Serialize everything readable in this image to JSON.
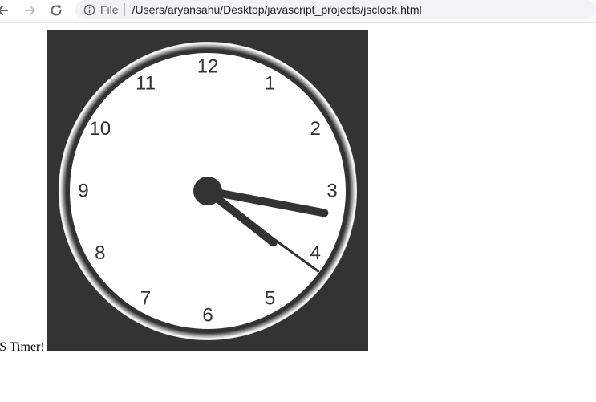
{
  "browser": {
    "scheme_label": "File",
    "url": "/Users/aryansahu/Desktop/javascript_projects/jsclock.html",
    "icons": {
      "back": "arrow-left",
      "forward": "arrow-right",
      "reload": "reload",
      "info": "info-circle"
    }
  },
  "page": {
    "body_text": "JS Timer!"
  },
  "clock": {
    "numerals": [
      "12",
      "1",
      "2",
      "3",
      "4",
      "5",
      "6",
      "7",
      "8",
      "9",
      "10",
      "11"
    ],
    "time": {
      "hour": 3,
      "minute": 21,
      "second": 21
    },
    "colors": {
      "background": "#333333",
      "face": "#ffffff",
      "hands": "#333333",
      "rim_light": "#ffffff",
      "rim_dark": "#333333"
    }
  }
}
